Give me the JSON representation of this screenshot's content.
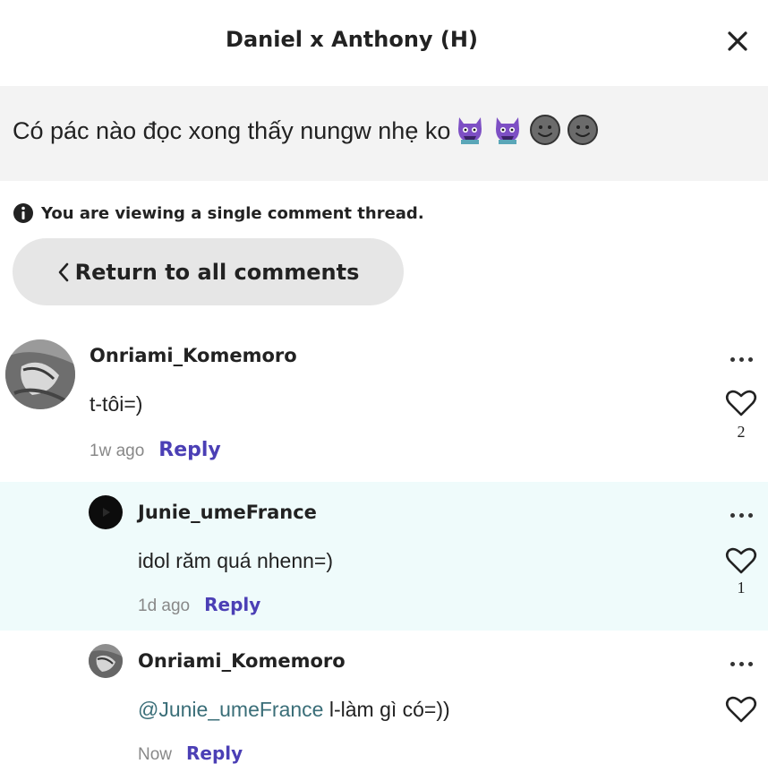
{
  "header": {
    "title": "Daniel x Anthony (H)"
  },
  "quote": {
    "text": "Có pác nào đọc xong thấy nungw nhẹ ko",
    "emojis": [
      "purple-demon-icon",
      "purple-demon-icon",
      "smiley-icon",
      "smiley-icon"
    ]
  },
  "notice": {
    "text": "You are viewing a single comment thread."
  },
  "return": {
    "label": "Return to all comments"
  },
  "comments": [
    {
      "username": "Onriami_Komemoro",
      "text": "t-tôi=)",
      "time": "1w ago",
      "reply": "Reply",
      "likes": "2"
    },
    {
      "username": "Junie_umeFrance",
      "text": "idol răm quá nhenn=)",
      "time": "1d ago",
      "reply": "Reply",
      "likes": "1"
    },
    {
      "username": "Onriami_Komemoro",
      "mention": "@Junie_umeFrance",
      "text": " l-làm gì có=))",
      "time": "Now",
      "reply": "Reply"
    }
  ],
  "colors": {
    "reply": "#4b3fb5",
    "highlight_bg": "#effbfb",
    "quote_bg": "#f3f3f3",
    "button_bg": "#e6e6e6",
    "mention": "#3a6e78"
  }
}
